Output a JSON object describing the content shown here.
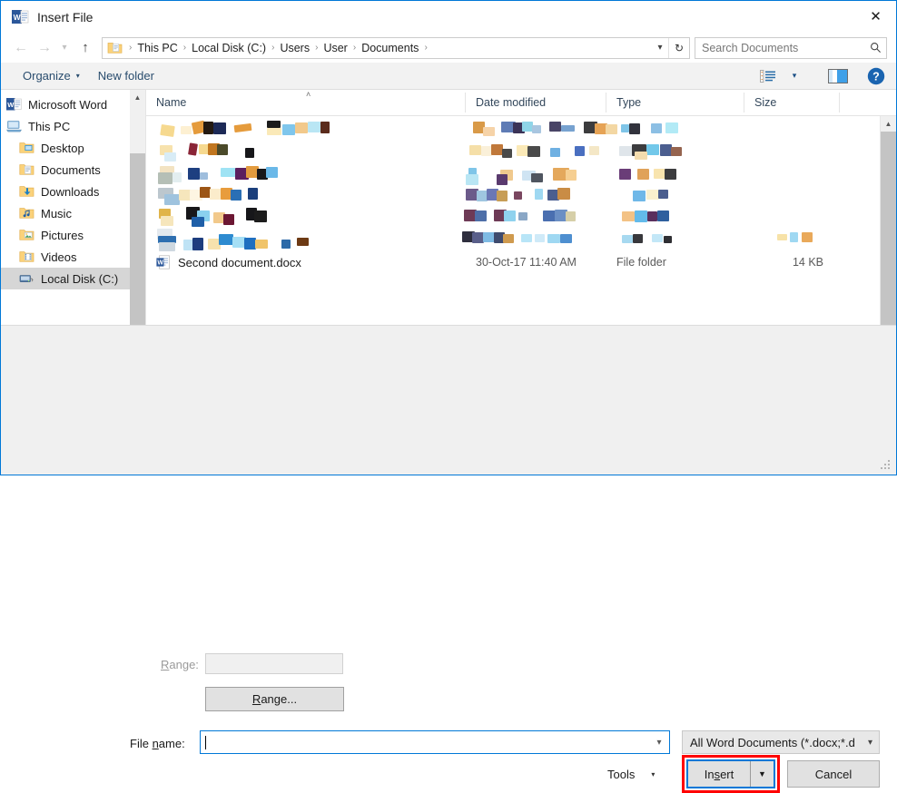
{
  "window": {
    "title": "Insert File",
    "app_icon": "word-icon",
    "close_label": "✕"
  },
  "nav": {
    "back_icon": "back-arrow-icon",
    "forward_icon": "forward-arrow-icon",
    "recent_icon": "chevron-down-icon",
    "up_icon": "up-arrow-icon",
    "address_icon": "documents-folder-icon",
    "breadcrumbs": [
      "This PC",
      "Local Disk (C:)",
      "Users",
      "User",
      "Documents"
    ],
    "separator": "›",
    "dropdown_icon": "chevron-down-icon",
    "refresh_icon": "refresh-icon",
    "refresh_glyph": "↻"
  },
  "search": {
    "placeholder": "Search Documents",
    "icon": "search-icon"
  },
  "command_bar": {
    "organize_label": "Organize",
    "organize_caret": "▾",
    "new_folder_label": "New folder",
    "view_icon": "view-options-icon",
    "view_caret": "▾",
    "preview_pane_icon": "preview-pane-icon",
    "help_icon": "help-icon",
    "help_glyph": "?"
  },
  "sidebar": {
    "items": [
      {
        "label": "Microsoft Word",
        "icon": "word-icon",
        "indent": 0,
        "selected": false
      },
      {
        "label": "This PC",
        "icon": "this-pc-icon",
        "indent": 0,
        "selected": false
      },
      {
        "label": "Desktop",
        "icon": "desktop-folder-icon",
        "indent": 1,
        "selected": false
      },
      {
        "label": "Documents",
        "icon": "documents-folder-icon",
        "indent": 1,
        "selected": false
      },
      {
        "label": "Downloads",
        "icon": "downloads-folder-icon",
        "indent": 1,
        "selected": false
      },
      {
        "label": "Music",
        "icon": "music-folder-icon",
        "indent": 1,
        "selected": false
      },
      {
        "label": "Pictures",
        "icon": "pictures-folder-icon",
        "indent": 1,
        "selected": false
      },
      {
        "label": "Videos",
        "icon": "videos-folder-icon",
        "indent": 1,
        "selected": false
      },
      {
        "label": "Local Disk (C:)",
        "icon": "local-disk-icon",
        "indent": 1,
        "selected": true
      }
    ]
  },
  "file_list": {
    "columns": [
      "Name",
      "Date modified",
      "Type",
      "Size"
    ],
    "sort_indicator": "˄",
    "rows": [
      {
        "name": "Second document.docx",
        "icon": "word-document-icon",
        "date_modified": "30-Oct-17 11:40 AM",
        "type": "File folder",
        "size": "14 KB"
      }
    ],
    "redacted_rows_note": "obscured file entries"
  },
  "form": {
    "range_label": "Range:",
    "range_label_mnemonic": "R",
    "range_value": "",
    "range_button_label": "Range...",
    "range_button_mnemonic": "R",
    "file_name_label": "File name:",
    "file_name_mnemonic": "n",
    "file_name_value": "",
    "file_name_dropdown_icon": "chevron-down-icon",
    "filter_value": "All Word Documents (*.docx;*.d",
    "filter_dropdown_icon": "chevron-down-icon"
  },
  "buttons": {
    "tools_label": "Tools",
    "tools_caret": "▾",
    "insert_label": "Insert",
    "insert_mnemonic": "s",
    "insert_split_caret": "▼",
    "cancel_label": "Cancel"
  },
  "colors": {
    "accent": "#0078d7",
    "highlight_rect": "#ff0000",
    "selection": "#d6d6d6",
    "chrome": "#f0f0f0",
    "link_text": "#2a4d6e"
  }
}
